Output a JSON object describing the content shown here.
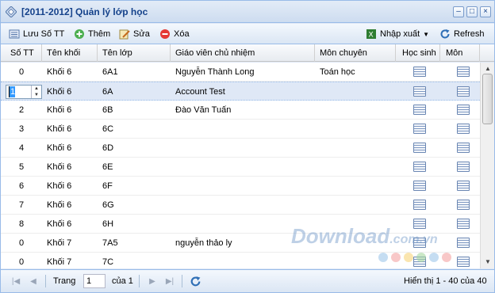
{
  "window": {
    "title": "[2011-2012] Quản lý lớp học"
  },
  "toolbar": {
    "sort_label": "Lưu Số TT",
    "add_label": "Thêm",
    "edit_label": "Sửa",
    "delete_label": "Xóa",
    "import_export_label": "Nhập xuất",
    "refresh_label": "Refresh"
  },
  "columns": [
    "Số TT",
    "Tên khối",
    "Tên lớp",
    "Giáo viên chủ nhiệm",
    "Môn chuyên",
    "Học sinh",
    "Môn học"
  ],
  "rows": [
    {
      "stt": "0",
      "khoi": "Khối 6",
      "lop": "6A1",
      "gvcn": "Nguyễn Thành Long",
      "mon": "Toán học"
    },
    {
      "stt": "1",
      "khoi": "Khối 6",
      "lop": "6A",
      "gvcn": "Account Test",
      "mon": ""
    },
    {
      "stt": "2",
      "khoi": "Khối 6",
      "lop": "6B",
      "gvcn": "Đào Văn Tuấn",
      "mon": ""
    },
    {
      "stt": "3",
      "khoi": "Khối 6",
      "lop": "6C",
      "gvcn": "",
      "mon": ""
    },
    {
      "stt": "4",
      "khoi": "Khối 6",
      "lop": "6D",
      "gvcn": "",
      "mon": ""
    },
    {
      "stt": "5",
      "khoi": "Khối 6",
      "lop": "6E",
      "gvcn": "",
      "mon": ""
    },
    {
      "stt": "6",
      "khoi": "Khối 6",
      "lop": "6F",
      "gvcn": "",
      "mon": ""
    },
    {
      "stt": "7",
      "khoi": "Khối 6",
      "lop": "6G",
      "gvcn": "",
      "mon": ""
    },
    {
      "stt": "8",
      "khoi": "Khối 6",
      "lop": "6H",
      "gvcn": "",
      "mon": ""
    },
    {
      "stt": "0",
      "khoi": "Khối 7",
      "lop": "7A5",
      "gvcn": "nguyễn thảo ly",
      "mon": ""
    },
    {
      "stt": "0",
      "khoi": "Khối 7",
      "lop": "7C",
      "gvcn": "",
      "mon": ""
    }
  ],
  "pager": {
    "page_label": "Trang",
    "page_value": "1",
    "of_label": "của 1",
    "status": "Hiển thị 1 - 40 của 40"
  },
  "watermark": {
    "text": "Download",
    "suffix": ".com.vn"
  },
  "colors": {
    "accent": "#15428b",
    "border": "#99bbe8",
    "selected": "#dfe8f6"
  }
}
